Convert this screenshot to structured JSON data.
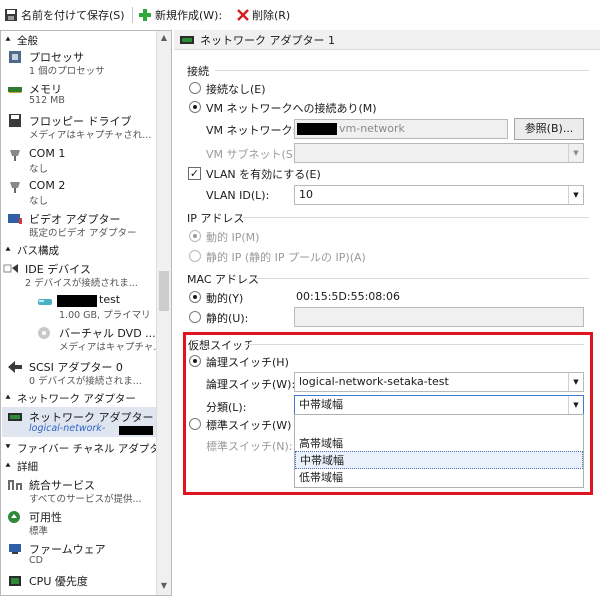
{
  "toolbar": {
    "save_as": "名前を付けて保存(S)",
    "new": "新規作成(W):",
    "delete": "削除(R)"
  },
  "left": {
    "sections": {
      "all": "全般",
      "bus": "バス構成",
      "network": "ネットワーク アダプター",
      "fibre": "ファイバー チャネル アダプター",
      "details": "詳細"
    },
    "items": {
      "processor": {
        "title": "プロセッサ",
        "sub": "1 個のプロセッサ"
      },
      "memory": {
        "title": "メモリ",
        "sub": "512 MB"
      },
      "floppy": {
        "title": "フロッピー ドライブ",
        "sub": "メディアはキャプチャされ..."
      },
      "com1": {
        "title": "COM 1",
        "sub": "なし"
      },
      "com2": {
        "title": "COM 2",
        "sub": "なし"
      },
      "video": {
        "title": "ビデオ アダプター",
        "sub": "既定のビデオ アダプター"
      },
      "ide": {
        "title": "IDE デバイス",
        "sub": "2 デバイスが接続されま..."
      },
      "disk": {
        "title": "test",
        "sub": "1.00 GB, プライマリ"
      },
      "dvd": {
        "title": "バーチャル DVD ...",
        "sub": "メディアはキャプチャ..."
      },
      "scsi": {
        "title": "SCSI アダプター 0",
        "sub": "0 デバイスが接続されま..."
      },
      "netadapter": {
        "title": "ネットワーク アダプター 1",
        "sub": "logical-network-"
      },
      "services": {
        "title": "統合サービス",
        "sub": "すべてのサービスが提供..."
      },
      "availability": {
        "title": "可用性",
        "sub": "標準"
      },
      "firmware": {
        "title": "ファームウェア",
        "sub": "CD"
      },
      "cpu": {
        "title": "CPU 優先度"
      }
    }
  },
  "right": {
    "title": "ネットワーク アダプター 1",
    "connection": {
      "header": "接続",
      "none": "接続なし(E)",
      "vm_network": "VM ネットワークへの接続あり(M)",
      "vm_network_label": "VM ネットワーク:",
      "vm_network_value": "vm-network",
      "browse": "参照(B)...",
      "vm_subnet_label": "VM サブネット(S):",
      "vlan_enable": "VLAN を有効にする(E)",
      "vlan_id_label": "VLAN ID(L):",
      "vlan_id_value": "10"
    },
    "ip": {
      "header": "IP アドレス",
      "dynamic": "動的 IP(M)",
      "static": "静的 IP (静的 IP プールの IP)(A)"
    },
    "mac": {
      "header": "MAC アドレス",
      "dynamic": "動的(Y)",
      "dynamic_value": "00:15:5D:55:08:06",
      "static": "静的(U):"
    },
    "vswitch": {
      "header": "仮想スイッチ",
      "logical": "論理スイッチ(H)",
      "logical_label": "論理スイッチ(W):",
      "logical_value": "logical-network-setaka-test",
      "class_label": "分類(L):",
      "class_value": "中帯域幅",
      "standard": "標準スイッチ(W)",
      "standard_label": "標準スイッチ(N):",
      "options": [
        "高帯域幅",
        "中帯域幅",
        "低帯域幅"
      ]
    }
  },
  "colors": {
    "highlight_box": "#e0141e",
    "link_blue": "#3163c8"
  }
}
